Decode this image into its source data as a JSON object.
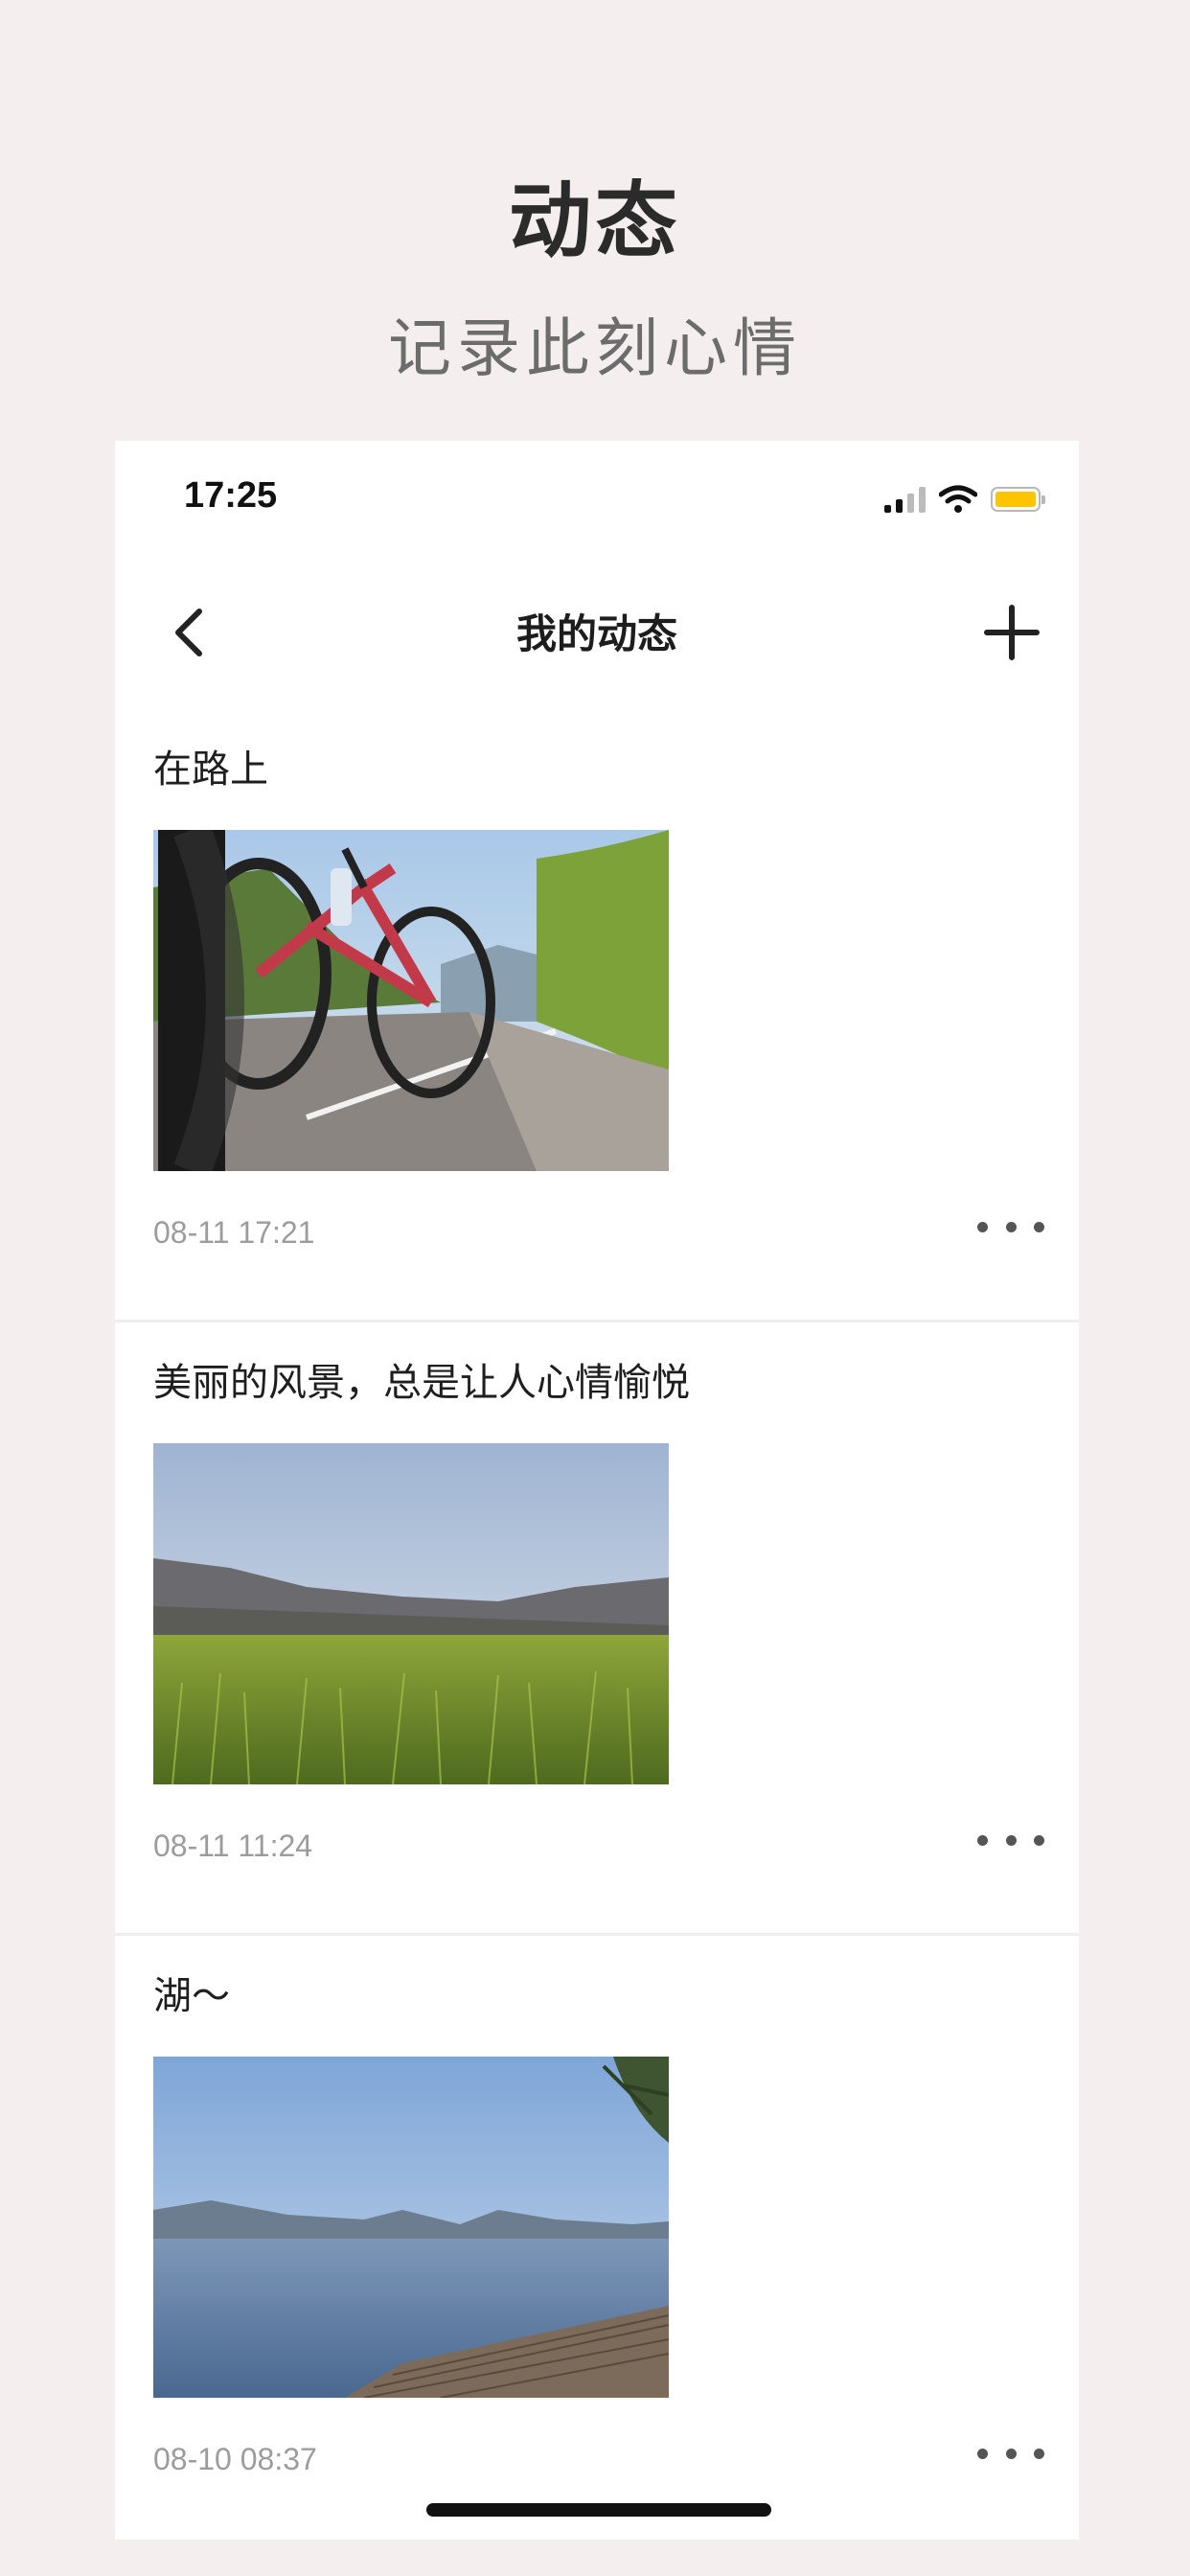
{
  "promo": {
    "title": "动态",
    "subtitle": "记录此刻心情"
  },
  "status_bar": {
    "time": "17:25",
    "battery_color": "#ffc400"
  },
  "nav": {
    "title": "我的动态",
    "back_icon": "chevron-left-icon",
    "add_icon": "plus-icon"
  },
  "posts": [
    {
      "text": "在路上",
      "time": "08-11 17:21",
      "image": "bicycle-road-photo"
    },
    {
      "text": "美丽的风景，总是让人心情愉悦",
      "time": "08-11 11:24",
      "image": "grassland-mountains-photo"
    },
    {
      "text": "湖～",
      "time": "08-10 08:37",
      "image": "lake-pier-photo"
    }
  ],
  "colors": {
    "background": "#f5eeee",
    "text_primary": "#1e1e1e",
    "text_secondary": "#9c9c9c"
  }
}
